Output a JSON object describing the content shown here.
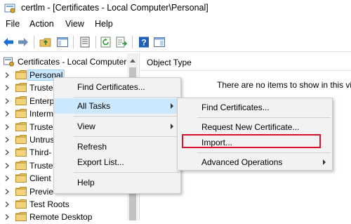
{
  "window": {
    "title": "certlm - [Certificates - Local Computer\\Personal]"
  },
  "menubar": [
    "File",
    "Action",
    "View",
    "Help"
  ],
  "toolbar": {
    "icons": [
      "back-arrow-icon",
      "forward-arrow-icon",
      "up-folder-icon",
      "show-hide-tree-icon",
      "properties-icon",
      "refresh-icon",
      "export-list-icon",
      "help-icon",
      "console-tree-icon"
    ]
  },
  "tree": {
    "root": "Certificates - Local Computer",
    "items": [
      "Personal",
      "Truste",
      "Enterp",
      "Interm",
      "Truste",
      "Untrus",
      "Third-",
      "Truste",
      "Client",
      "Previe",
      "Test Roots",
      "Remote Desktop"
    ]
  },
  "content": {
    "column_header": "Object Type",
    "empty_message": "There are no items to show in this vie"
  },
  "context_menu": {
    "items": [
      "Find Certificates...",
      "All Tasks",
      "View",
      "Refresh",
      "Export List...",
      "Help"
    ]
  },
  "submenu": {
    "items": [
      "Find Certificates...",
      "Request New Certificate...",
      "Import...",
      "Advanced Operations"
    ]
  },
  "colors": {
    "highlight": "#cce8ff",
    "menu_bg": "#f2f2f2",
    "callout": "#d9112b",
    "folder": "#e8c15b"
  }
}
